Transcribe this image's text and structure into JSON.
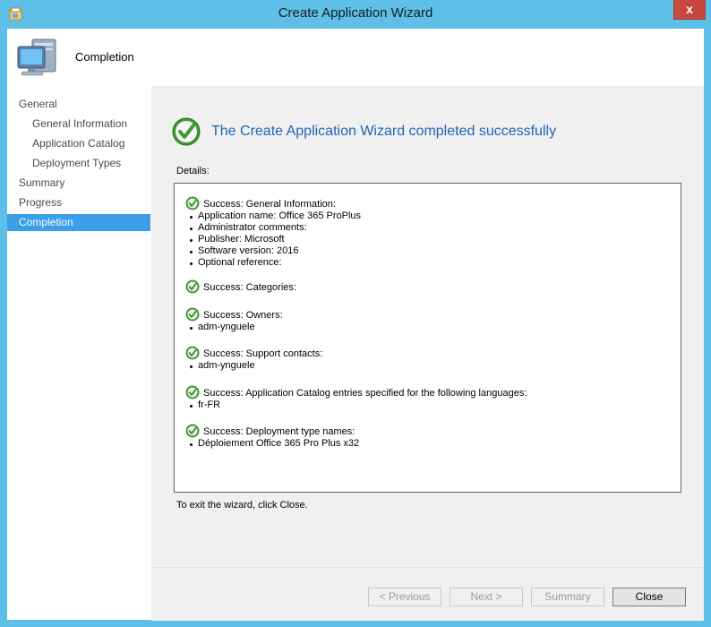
{
  "window": {
    "title": "Create Application Wizard",
    "close_label": "x"
  },
  "header": {
    "title": "Completion"
  },
  "nav": {
    "items": [
      {
        "label": "General",
        "level": "top"
      },
      {
        "label": "General Information",
        "level": "sub"
      },
      {
        "label": "Application Catalog",
        "level": "sub"
      },
      {
        "label": "Deployment Types",
        "level": "sub"
      },
      {
        "label": "Summary",
        "level": "top"
      },
      {
        "label": "Progress",
        "level": "top"
      },
      {
        "label": "Completion",
        "level": "top",
        "selected": true
      }
    ]
  },
  "main": {
    "heading": "The Create Application Wizard completed successfully",
    "details_label": "Details:",
    "entries": [
      {
        "status": "Success: General Information:",
        "bullets": [
          "Application name: Office 365 ProPlus",
          "Administrator comments:",
          "Publisher: Microsoft",
          "Software version: 2016",
          "Optional reference:"
        ]
      },
      {
        "status": "Success: Categories:",
        "bullets": []
      },
      {
        "status": "Success: Owners:",
        "bullets": [
          "adm-ynguele"
        ]
      },
      {
        "status": "Success: Support contacts:",
        "bullets": [
          "adm-ynguele"
        ]
      },
      {
        "status": "Success: Application Catalog entries specified for the following languages:",
        "bullets": [
          "fr-FR"
        ]
      },
      {
        "status": "Success: Deployment type names:",
        "bullets": [
          "Déploiement Office 365 Pro Plus x32"
        ]
      }
    ],
    "exit_text": "To exit the wizard, click Close."
  },
  "footer": {
    "previous": "< Previous",
    "next": "Next >",
    "summary": "Summary",
    "close": "Close"
  },
  "colors": {
    "titlebar": "#5ec0e8",
    "selection": "#3a9ee8",
    "heading": "#1e65b8",
    "close_button": "#c7483f"
  }
}
